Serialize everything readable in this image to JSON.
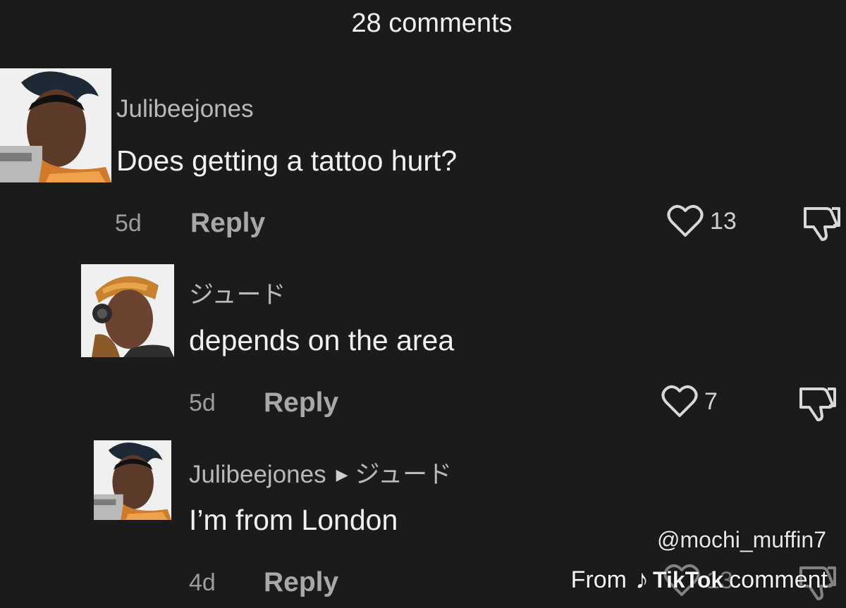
{
  "header": {
    "title": "28 comments"
  },
  "comments": [
    {
      "avatar": "agent-portrait-1",
      "username": "Julibeejones",
      "text": "Does getting a tattoo hurt?",
      "time": "5d",
      "reply_label": "Reply",
      "likes": "13"
    },
    {
      "avatar": "agent-portrait-2",
      "username": "ジュード",
      "text": "depends on the area",
      "time": "5d",
      "reply_label": "Reply",
      "likes": "7"
    },
    {
      "avatar": "agent-portrait-1",
      "username": "Julibeejones",
      "reply_to": "ジュード",
      "text": "I’m from London",
      "time": "4d",
      "reply_label": "Reply",
      "likes": "13"
    }
  ],
  "watermark": {
    "handle": "@mochi_muffin7",
    "from": "From",
    "brand": "TikTok",
    "suffix": "comment"
  },
  "colors": {
    "background": "#1b1b1b",
    "text": "#f1f1f1",
    "muted": "#9c9c9c"
  }
}
